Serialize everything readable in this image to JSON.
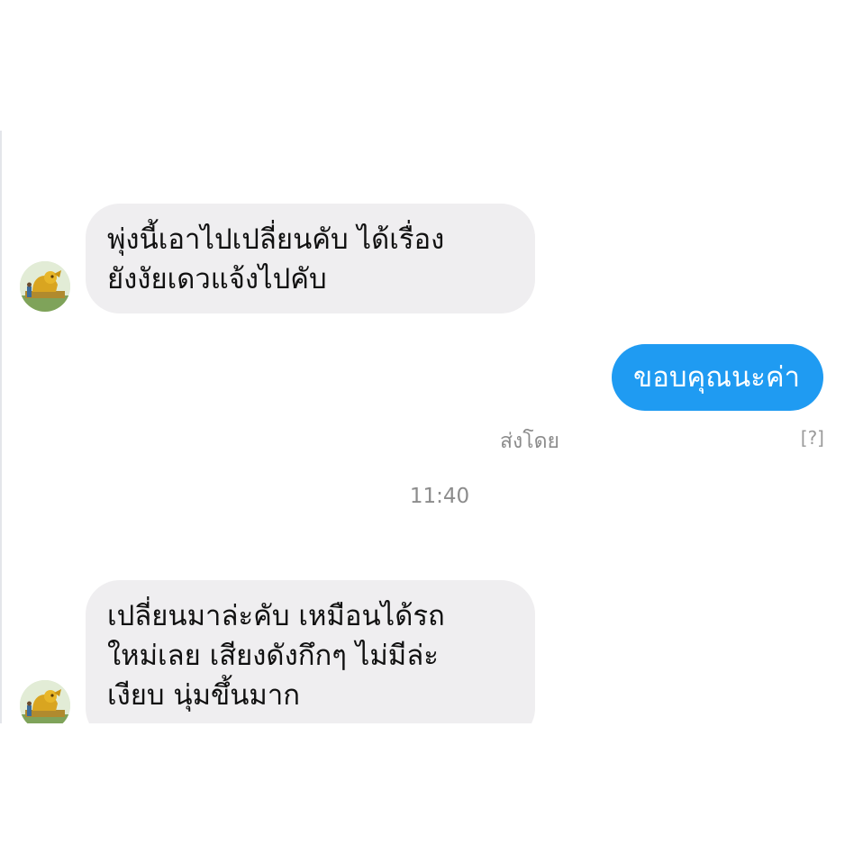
{
  "conversation": {
    "messages": [
      {
        "direction": "incoming",
        "lines": [
          "พุ่งนี้เอาไปเปลี่ยนคับ ได้เรื่อง",
          "ยังงัยเดวแจ้งไปคับ"
        ]
      },
      {
        "direction": "outgoing",
        "text": "ขอบคุณนะค่า",
        "sent_by_label": "ส่งโดย",
        "help_label": "[?]"
      },
      {
        "direction": "incoming",
        "lines": [
          "เปลี่ยนมาล่ะคับ เหมือนได้รถ",
          "ใหม่เลย เสียงดังกึกๆ ไม่มีล่ะ",
          "เงียบ นุ่มขึ้นมาก"
        ]
      }
    ],
    "timestamp": "11:40"
  },
  "colors": {
    "incoming_bubble": "#efeef0",
    "outgoing_bubble": "#1f9bf2",
    "meta_text": "#8c8c8c"
  },
  "icons": {
    "avatar": "golden-lion-statue-avatar"
  }
}
